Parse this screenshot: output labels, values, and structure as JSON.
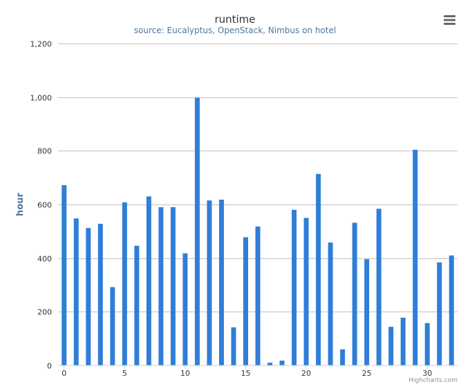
{
  "chart_data": {
    "type": "bar",
    "title": "runtime",
    "subtitle": "source: Eucalyptus, OpenStack, Nimbus on hotel",
    "ylabel": "hour",
    "xlabel": "",
    "x": [
      0,
      1,
      2,
      3,
      4,
      5,
      6,
      7,
      8,
      9,
      10,
      11,
      12,
      13,
      14,
      15,
      16,
      17,
      18,
      19,
      20,
      21,
      22,
      23,
      24,
      25,
      26,
      27,
      28,
      29,
      30,
      31,
      32
    ],
    "values": [
      672,
      548,
      512,
      528,
      292,
      608,
      446,
      630,
      590,
      590,
      418,
      998,
      615,
      618,
      142,
      478,
      518,
      10,
      18,
      580,
      550,
      714,
      458,
      60,
      532,
      396,
      584,
      144,
      178,
      804,
      158,
      384,
      410
    ],
    "ylim": [
      0,
      1200
    ],
    "yticks": [
      0,
      200,
      400,
      600,
      800,
      1000,
      1200
    ],
    "ytick_labels": [
      "0",
      "200",
      "400",
      "600",
      "800",
      "1,000",
      "1,200"
    ],
    "xticks": [
      0,
      5,
      10,
      15,
      20,
      25,
      30
    ],
    "xtick_labels": [
      "0",
      "5",
      "10",
      "15",
      "20",
      "25",
      "30"
    ],
    "grid": true,
    "legend": "none",
    "bar_color": "#2f7ed8",
    "grid_color": "#c0c0c0",
    "credits": "Highcharts.com"
  },
  "icons": {
    "menu": "menu-icon"
  }
}
